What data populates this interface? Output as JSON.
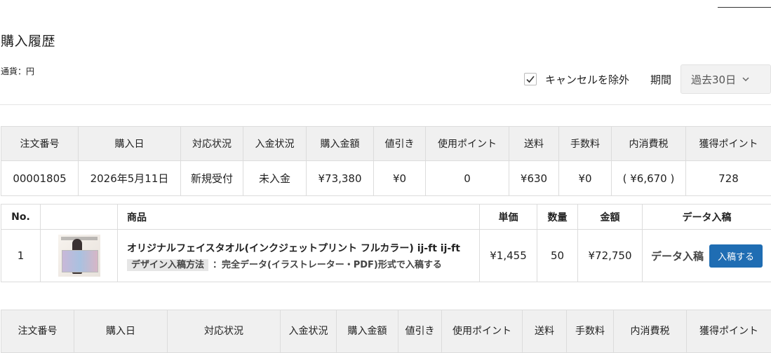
{
  "page": {
    "title": "購入履歴",
    "currency": "通貨：円"
  },
  "filters": {
    "cancel_label": "キャンセルを除外",
    "cancel_checked": true,
    "period_label": "期間",
    "period_value": "過去30日"
  },
  "order_table": {
    "headers": [
      "注文番号",
      "購入日",
      "対応状況",
      "入金状況",
      "購入金額",
      "値引き",
      "使用ポイント",
      "送料",
      "手数料",
      "内消費税",
      "獲得ポイント"
    ],
    "row": [
      "00001805",
      "2026年5月11日",
      "新規受付",
      "未入金",
      "¥73,380",
      "¥0",
      "0",
      "¥630",
      "¥0",
      "( ¥6,670 )",
      "728"
    ]
  },
  "items_table": {
    "headers": {
      "no": "No.",
      "product": "商品",
      "unit_price": "単価",
      "quantity": "数量",
      "amount": "金額",
      "data_submit": "データ入稿"
    },
    "item": {
      "no": "1",
      "name": "オリジナルフェイスタオル(インクジェットプリント フルカラー) ij-ft ij-ft",
      "design_badge": "デザイン入稿方法",
      "design_text": "：完全データ(イラストレーター・PDF)形式で入稿する",
      "unit_price": "¥1,455",
      "quantity": "50",
      "amount": "¥72,750",
      "data_label": "データ入稿",
      "submit_button": "入稿する"
    }
  },
  "order_table2": {
    "headers": [
      "注文番号",
      "購入日",
      "対応状況",
      "入金状況",
      "購入金額",
      "値引き",
      "使用ポイント",
      "送料",
      "手数料",
      "内消費税",
      "獲得ポイント"
    ]
  },
  "colors": {
    "primary_button": "#1f6db3",
    "header_bg": "#f0f0f0"
  }
}
